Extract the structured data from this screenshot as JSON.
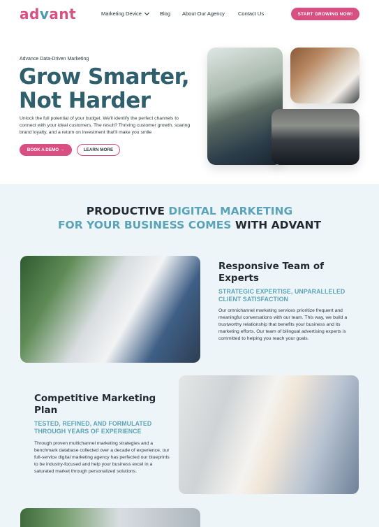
{
  "header": {
    "logo_part1": "ad",
    "logo_part2": "v",
    "logo_part3": "ant",
    "nav": [
      "Marketing Device",
      "Blog",
      "About Our Agency",
      "Contact Us"
    ],
    "cta": "START GROWING NOW!"
  },
  "hero": {
    "eyebrow": "Advance Data-Driven Marketing",
    "title_line1": "Grow Smarter,",
    "title_line2": "Not Harder",
    "description": "Unlock the full potential of your budget. We'll identify the perfect channels to connect with your ideal customers. The result? Thriving customer growth, soaring brand loyalty, and a return on investment that'll make you smile",
    "btn_demo": "BOOK A DEMO →",
    "btn_more": "LEARN MORE"
  },
  "section": {
    "title_a": "PRODUCTIVE ",
    "title_b": "DIGITAL MARKETING",
    "title_c": "FOR YOUR BUSINESS COMES",
    "title_d": " WITH ADVANT",
    "features": [
      {
        "title": "Responsive Team of Experts",
        "subtitle": "STRATEGIC EXPERTISE, UNPARALLELED CLIENT SATISFACTION",
        "body": "Our omnichannel marketing services prioritize frequent and meaningful conversations with our team. This way, we build a trustworthy relationship that benefits your business and its marketing efforts. Our team of bilingual advertising experts is committed to helping you reach your goals."
      },
      {
        "title": "Competitive Marketing Plan",
        "subtitle": "TESTED, REFINED, AND FORMULATED THROUGH YEARS OF EXPERIENCE",
        "body": "Through proven multichannel marketing strategies and a benchmark database collected over a decade of experience, our full-service digital marketing agency has perfected our blueprints to be industry-focused and help your business excel in a saturated market through personalized solutions."
      }
    ]
  },
  "colors": {
    "accent_pink": "#d94f82",
    "accent_teal": "#5aa3b8",
    "heading_dark_teal": "#2f5f6c",
    "section_bg": "#eef5f8"
  }
}
